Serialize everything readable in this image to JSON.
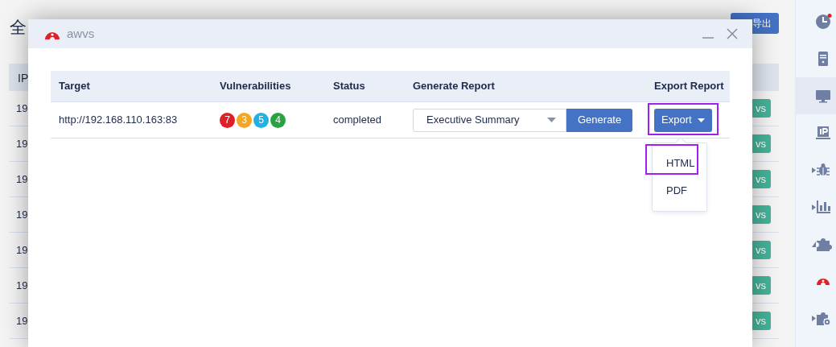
{
  "background_page": {
    "title": "全",
    "export_button": "导出",
    "table": {
      "header": "IP",
      "rows": [
        {
          "cell": "19",
          "tag": "vs"
        },
        {
          "cell": "19",
          "tag": "vs"
        },
        {
          "cell": "19",
          "tag": "vs"
        },
        {
          "cell": "19",
          "tag": "vs"
        },
        {
          "cell": "19",
          "tag": "vs"
        },
        {
          "cell": "19",
          "tag": "vs"
        },
        {
          "cell": "19",
          "tag": "vs"
        }
      ]
    }
  },
  "sidebar": {
    "items": [
      {
        "kind": "clock",
        "selected": false,
        "notification": true,
        "expandable": false
      },
      {
        "kind": "server",
        "selected": false,
        "notification": false,
        "expandable": false
      },
      {
        "kind": "monitor",
        "selected": true,
        "notification": false,
        "expandable": false
      },
      {
        "kind": "ip",
        "selected": false,
        "notification": false,
        "expandable": false
      },
      {
        "kind": "bug",
        "selected": false,
        "notification": false,
        "expandable": true,
        "expanded": false
      },
      {
        "kind": "chart",
        "selected": false,
        "notification": false,
        "expandable": true,
        "expanded": false
      },
      {
        "kind": "puzzle",
        "selected": false,
        "notification": false,
        "expandable": true,
        "expanded": true
      },
      {
        "kind": "logo",
        "selected": false,
        "notification": false,
        "expandable": false
      },
      {
        "kind": "plugin",
        "selected": false,
        "notification": false,
        "expandable": true,
        "expanded": false
      }
    ]
  },
  "modal": {
    "title": "awvs",
    "columns": [
      "Target",
      "Vulnerabilities",
      "Status",
      "Generate Report",
      "Export Report"
    ],
    "rows": [
      {
        "target": "http://192.168.110.163:83",
        "vulnerabilities": [
          {
            "count": "7",
            "color": "#e02027"
          },
          {
            "count": "3",
            "color": "#f5a623"
          },
          {
            "count": "5",
            "color": "#22b1e3"
          },
          {
            "count": "4",
            "color": "#29a33f"
          }
        ],
        "status": "completed",
        "report_template": "Executive Summary",
        "generate_button": "Generate",
        "export_button": {
          "label": "Export",
          "highlighted": true
        }
      }
    ],
    "export_menu": {
      "open": true,
      "items": [
        {
          "label": "HTML",
          "highlighted": true
        },
        {
          "label": "PDF",
          "highlighted": false
        }
      ]
    }
  }
}
